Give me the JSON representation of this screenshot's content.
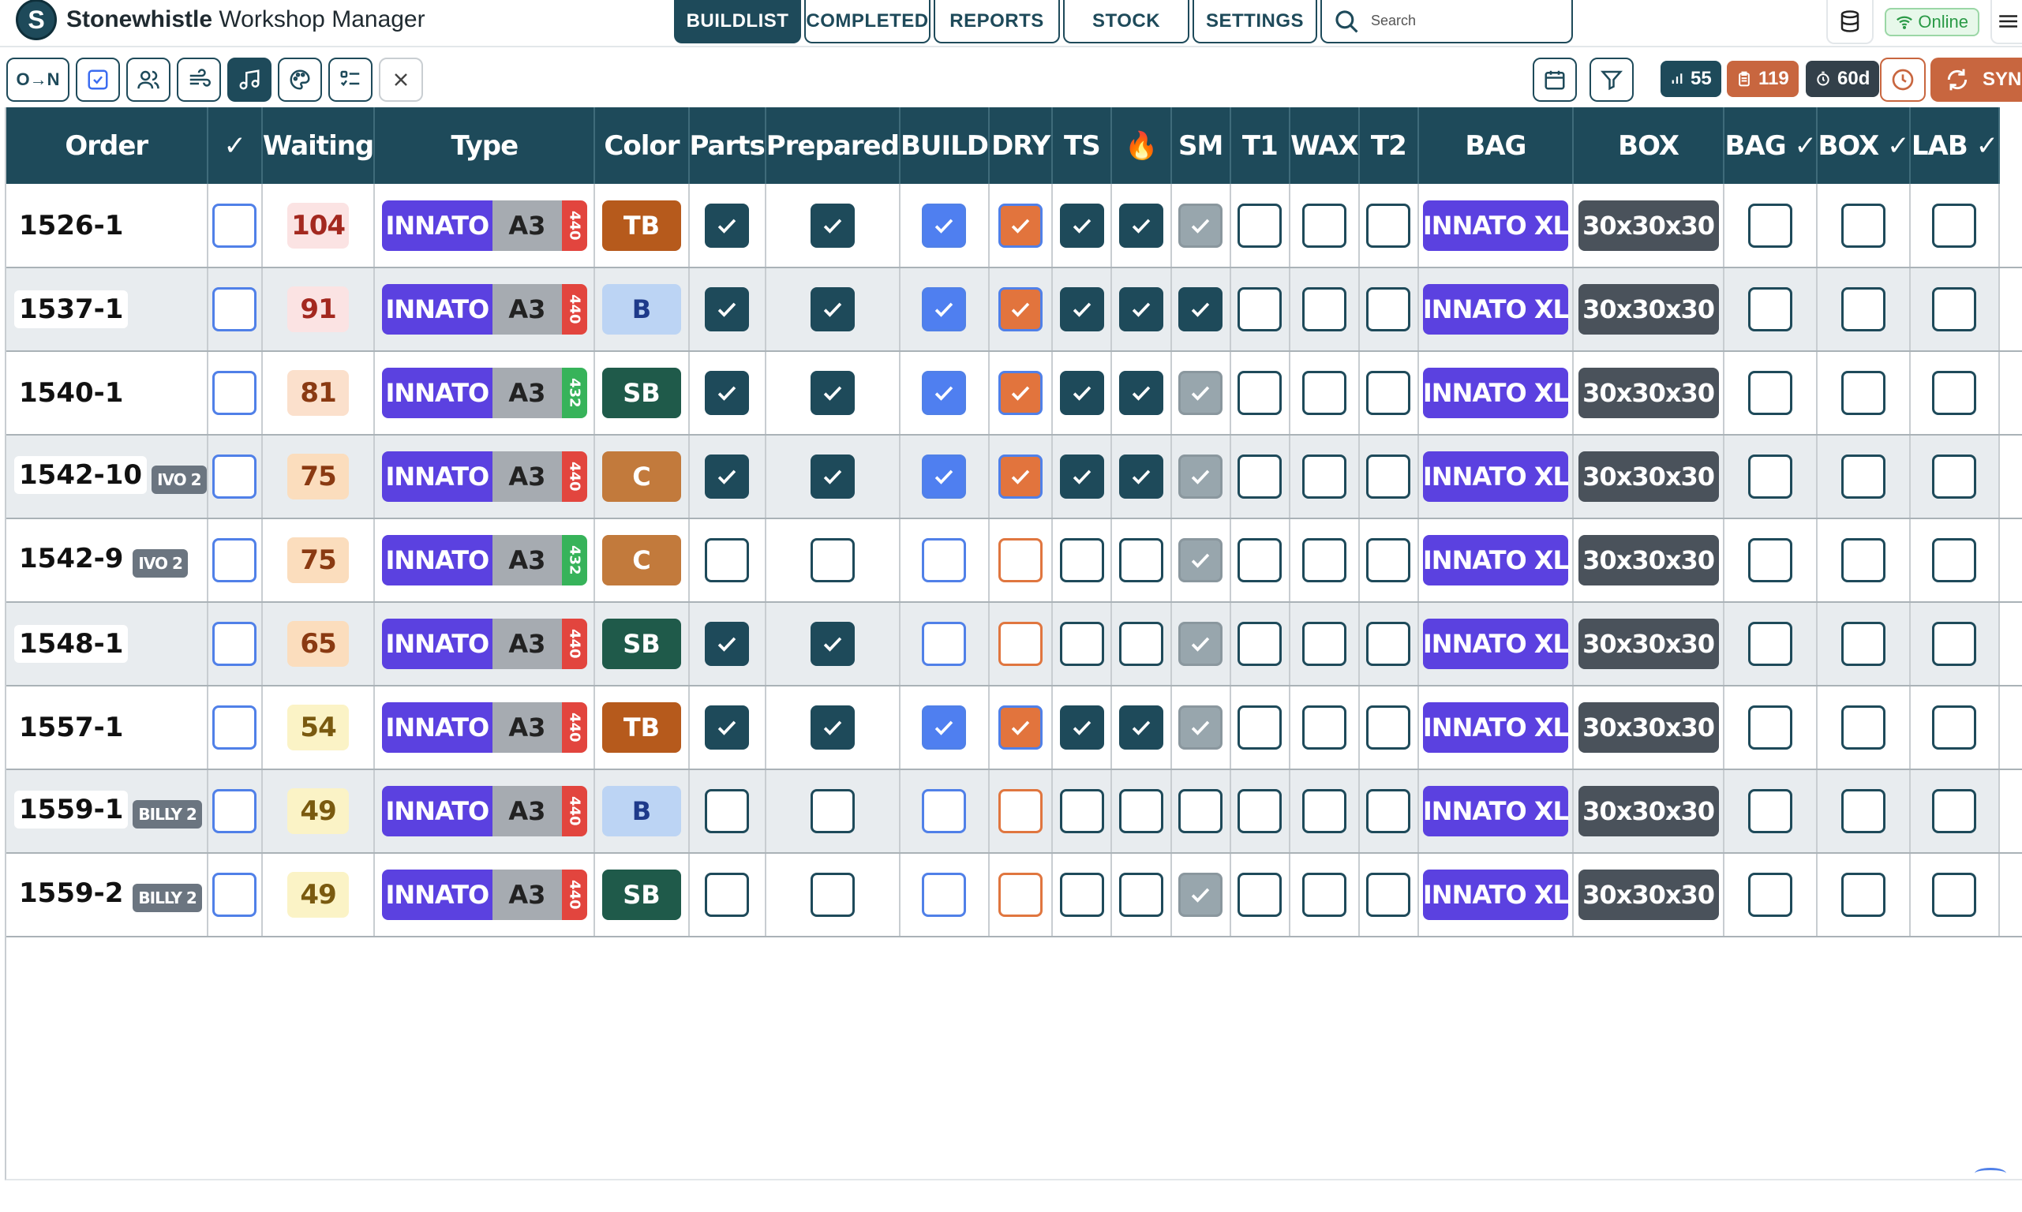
{
  "brand": {
    "name_bold": "Stonewhistle",
    "name_rest": " Workshop Manager",
    "logo_letter": "S"
  },
  "nav": {
    "tabs": [
      {
        "label": "BUILDLIST",
        "active": true
      },
      {
        "label": "COMPLETED"
      },
      {
        "label": "REPORTS"
      },
      {
        "label": "STOCK"
      },
      {
        "label": "SETTINGS"
      }
    ],
    "search_placeholder": "Search"
  },
  "status": {
    "online_label": "Online"
  },
  "toolbar": {
    "order_toggle_label": "O→N",
    "stats": {
      "count": "55",
      "orders": "119",
      "days": "60d"
    },
    "sync_label": "SYNC"
  },
  "columns": [
    "Order",
    "✓",
    "Waiting",
    "Type",
    "Color",
    "Parts",
    "Prepared",
    "BUILD",
    "DRY",
    "TS",
    "🔥",
    "SM",
    "T1",
    "WAX",
    "T2",
    "BAG",
    "BOX",
    "BAG ✓",
    "BOX ✓",
    "LAB ✓"
  ],
  "colors": {
    "accent": "#1e4a5a",
    "type_purple": "#5b41e0",
    "tb": "#b65a1c",
    "b": "#bcd4f4",
    "sb": "#1f5a4a",
    "c": "#c27a3c",
    "freq_440": "#e2453e",
    "freq_432": "#37b35a"
  },
  "rows": [
    {
      "order": "1526-1",
      "tag": "",
      "waiting": "104",
      "wait_bg": "#fbe3e3",
      "wait_fg": "#a3281f",
      "type": "INNATO",
      "key": "A3",
      "freq": "440",
      "color": "TB",
      "parts": true,
      "prepared": true,
      "build": true,
      "dry": true,
      "ts": true,
      "fire": true,
      "sm": true,
      "t1": false,
      "wax": false,
      "t2": false,
      "bag": "INNATO XL",
      "box": "30x30x30"
    },
    {
      "order": "1537-1",
      "tag": "",
      "waiting": "91",
      "wait_bg": "#fbe3e3",
      "wait_fg": "#a3281f",
      "type": "INNATO",
      "key": "A3",
      "freq": "440",
      "color": "B",
      "parts": true,
      "prepared": true,
      "build": true,
      "dry": true,
      "ts": true,
      "fire": true,
      "sm": true,
      "sm_dark": true,
      "t1": false,
      "wax": false,
      "t2": false,
      "bag": "INNATO XL",
      "box": "30x30x30"
    },
    {
      "order": "1540-1",
      "tag": "",
      "waiting": "81",
      "wait_bg": "#fbe0cc",
      "wait_fg": "#8a3a12",
      "type": "INNATO",
      "key": "A3",
      "freq": "432",
      "color": "SB",
      "parts": true,
      "prepared": true,
      "build": true,
      "dry": true,
      "ts": true,
      "fire": true,
      "sm": true,
      "t1": false,
      "wax": false,
      "t2": false,
      "bag": "INNATO XL",
      "box": "30x30x30"
    },
    {
      "order": "1542-10",
      "tag": "IVO 2",
      "waiting": "75",
      "wait_bg": "#fbddbd",
      "wait_fg": "#8a3a12",
      "type": "INNATO",
      "key": "A3",
      "freq": "440",
      "color": "C",
      "parts": true,
      "prepared": true,
      "build": true,
      "dry": true,
      "ts": true,
      "fire": true,
      "sm": true,
      "t1": false,
      "wax": false,
      "t2": false,
      "bag": "INNATO XL",
      "box": "30x30x30"
    },
    {
      "order": "1542-9",
      "tag": "IVO 2",
      "waiting": "75",
      "wait_bg": "#fbddbd",
      "wait_fg": "#8a3a12",
      "type": "INNATO",
      "key": "A3",
      "freq": "432",
      "color": "C",
      "parts": false,
      "prepared": false,
      "build": false,
      "dry": false,
      "ts": false,
      "fire": false,
      "sm": true,
      "t1": false,
      "wax": false,
      "t2": false,
      "bag": "INNATO XL",
      "box": "30x30x30"
    },
    {
      "order": "1548-1",
      "tag": "",
      "waiting": "65",
      "wait_bg": "#fbddbd",
      "wait_fg": "#8a3a12",
      "type": "INNATO",
      "key": "A3",
      "freq": "440",
      "color": "SB",
      "parts": true,
      "prepared": true,
      "build": false,
      "dry": false,
      "ts": false,
      "fire": false,
      "sm": true,
      "t1": false,
      "wax": false,
      "t2": false,
      "bag": "INNATO XL",
      "box": "30x30x30"
    },
    {
      "order": "1557-1",
      "tag": "",
      "waiting": "54",
      "wait_bg": "#fbf3c6",
      "wait_fg": "#7a5a10",
      "type": "INNATO",
      "key": "A3",
      "freq": "440",
      "color": "TB",
      "parts": true,
      "prepared": true,
      "build": true,
      "dry": true,
      "ts": true,
      "fire": true,
      "sm": true,
      "t1": false,
      "wax": false,
      "t2": false,
      "bag": "INNATO XL",
      "box": "30x30x30"
    },
    {
      "order": "1559-1",
      "tag": "BILLY 2",
      "waiting": "49",
      "wait_bg": "#fbf3c6",
      "wait_fg": "#7a5a10",
      "type": "INNATO",
      "key": "A3",
      "freq": "440",
      "color": "B",
      "parts": false,
      "prepared": false,
      "build": false,
      "dry": false,
      "ts": false,
      "fire": false,
      "sm": false,
      "t1": false,
      "wax": false,
      "t2": false,
      "bag": "INNATO XL",
      "box": "30x30x30"
    },
    {
      "order": "1559-2",
      "tag": "BILLY 2",
      "waiting": "49",
      "wait_bg": "#fbf3c6",
      "wait_fg": "#7a5a10",
      "type": "INNATO",
      "key": "A3",
      "freq": "440",
      "color": "SB",
      "parts": false,
      "prepared": false,
      "build": false,
      "dry": false,
      "ts": false,
      "fire": false,
      "sm": true,
      "t1": false,
      "wax": false,
      "t2": false,
      "bag": "INNATO XL",
      "box": "30x30x30"
    }
  ]
}
